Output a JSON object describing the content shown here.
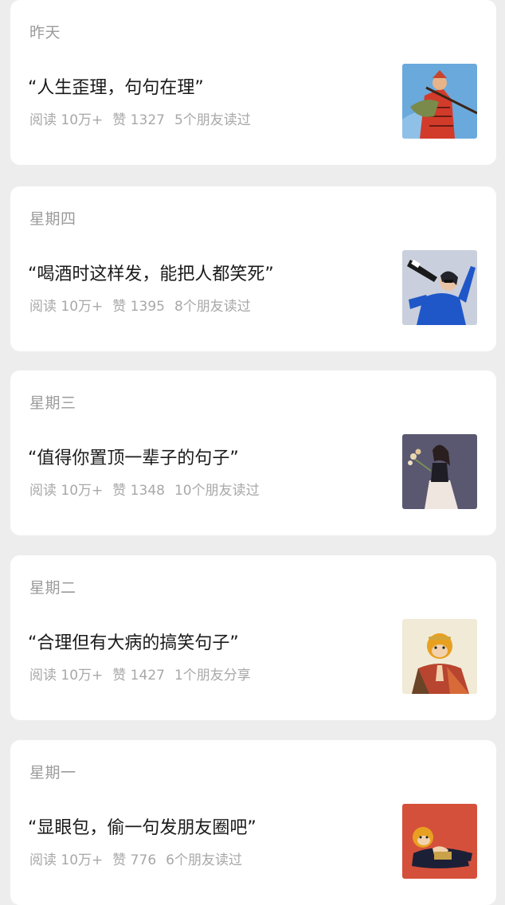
{
  "articles": [
    {
      "date": "昨天",
      "title": "“人生歪理，句句在理”",
      "reads": "阅读 10万+",
      "likes": "赞 1327",
      "friends": "5个朋友读过",
      "thumb": {
        "icon": "monkey-king-spear-illustration",
        "bg": "#6aa9dc",
        "accent": "#d23b2a"
      }
    },
    {
      "date": "星期四",
      "title": "“喝酒时这样发，能把人都笑死”",
      "reads": "阅读 10万+",
      "likes": "赞 1395",
      "friends": "8个朋友读过",
      "thumb": {
        "icon": "person-drinking-bottle-illustration",
        "bg": "#c9cfdc",
        "accent": "#1f57c9"
      }
    },
    {
      "date": "星期三",
      "title": "“值得你置顶一辈子的句子”",
      "reads": "阅读 10万+",
      "likes": "赞 1348",
      "friends": "10个朋友读过",
      "thumb": {
        "icon": "woman-holding-flowers-illustration",
        "bg": "#5a5870",
        "accent": "#efe6df"
      }
    },
    {
      "date": "星期二",
      "title": "“合理但有大病的搞笑句子”",
      "reads": "阅读 10万+",
      "likes": "赞 1427",
      "friends": "1个朋友分享",
      "thumb": {
        "icon": "monk-praying-illustration",
        "bg": "#f1ead6",
        "accent": "#e8a020"
      }
    },
    {
      "date": "星期一",
      "title": "“显眼包，偷一句发朋友圈吧”",
      "reads": "阅读 10万+",
      "likes": "赞 776",
      "friends": "6个朋友读过",
      "thumb": {
        "icon": "monkey-lying-down-illustration",
        "bg": "#d5503b",
        "accent": "#1c2036"
      }
    }
  ]
}
